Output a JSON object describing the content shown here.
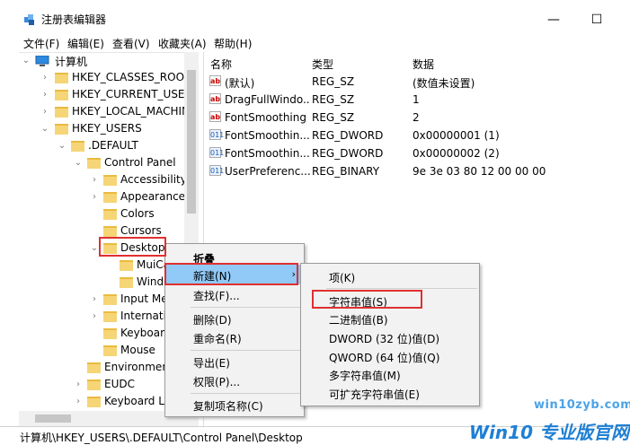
{
  "window": {
    "title": "注册表编辑器",
    "min_glyph": "—",
    "max_glyph": "☐"
  },
  "menubar": [
    "文件(F)",
    "编辑(E)",
    "查看(V)",
    "收藏夹(A)",
    "帮助(H)"
  ],
  "tree": [
    {
      "label": "计算机",
      "expander": "⌄",
      "icon": "computer-icon"
    },
    {
      "label": "HKEY_CLASSES_ROOT",
      "expander": "›"
    },
    {
      "label": "HKEY_CURRENT_USER",
      "expander": "›"
    },
    {
      "label": "HKEY_LOCAL_MACHINE",
      "expander": "›"
    },
    {
      "label": "HKEY_USERS",
      "expander": "⌄"
    },
    {
      "label": ".DEFAULT",
      "expander": "⌄"
    },
    {
      "label": "Control Panel",
      "expander": "⌄"
    },
    {
      "label": "Accessibility",
      "expander": "›"
    },
    {
      "label": "Appearance",
      "expander": "›"
    },
    {
      "label": "Colors",
      "expander": ""
    },
    {
      "label": "Cursors",
      "expander": ""
    },
    {
      "label": "Desktop",
      "expander": "⌄"
    },
    {
      "label": "MuiCa",
      "expander": ""
    },
    {
      "label": "Windo",
      "expander": ""
    },
    {
      "label": "Input Me",
      "expander": "›"
    },
    {
      "label": "Internatio",
      "expander": "›"
    },
    {
      "label": "Keyboard",
      "expander": ""
    },
    {
      "label": "Mouse",
      "expander": ""
    },
    {
      "label": "Environment",
      "expander": ""
    },
    {
      "label": "EUDC",
      "expander": "›"
    },
    {
      "label": "Keyboard La",
      "expander": "›"
    }
  ],
  "list": {
    "headers": [
      "名称",
      "类型",
      "数据"
    ],
    "rows": [
      {
        "icon": "string-value-icon",
        "icon_text": "ab",
        "name": "(默认)",
        "type": "REG_SZ",
        "data": "(数值未设置)"
      },
      {
        "icon": "string-value-icon",
        "icon_text": "ab",
        "name": "DragFullWindo...",
        "type": "REG_SZ",
        "data": "1"
      },
      {
        "icon": "string-value-icon",
        "icon_text": "ab",
        "name": "FontSmoothing",
        "type": "REG_SZ",
        "data": "2"
      },
      {
        "icon": "binary-value-icon",
        "icon_text": "011",
        "name": "FontSmoothin...",
        "type": "REG_DWORD",
        "data": "0x00000001 (1)"
      },
      {
        "icon": "binary-value-icon",
        "icon_text": "011",
        "name": "FontSmoothin...",
        "type": "REG_DWORD",
        "data": "0x00000002 (2)"
      },
      {
        "icon": "binary-value-icon",
        "icon_text": "011",
        "name": "UserPreferenc...",
        "type": "REG_BINARY",
        "data": "9e 3e 03 80 12 00 00 00"
      }
    ]
  },
  "context_menu": {
    "collapse": "折叠",
    "new": "新建(N)",
    "find": "查找(F)...",
    "delete": "删除(D)",
    "rename": "重命名(R)",
    "export": "导出(E)",
    "permissions": "权限(P)...",
    "copy_key_name": "复制项名称(C)",
    "submenu_arrow": "›"
  },
  "submenu": [
    "项(K)",
    "字符串值(S)",
    "二进制值(B)",
    "DWORD (32 位)值(D)",
    "QWORD (64 位)值(Q)",
    "多字符串值(M)",
    "可扩充字符串值(E)"
  ],
  "statusbar": {
    "path": "计算机\\HKEY_USERS\\.DEFAULT\\Control Panel\\Desktop"
  },
  "watermark": {
    "url": "win10zyb.com",
    "logo": "Win10 专业版官网"
  },
  "colors": {
    "highlight": "#91c9f7",
    "callout": "#e03030",
    "folder": "#f6d577"
  }
}
